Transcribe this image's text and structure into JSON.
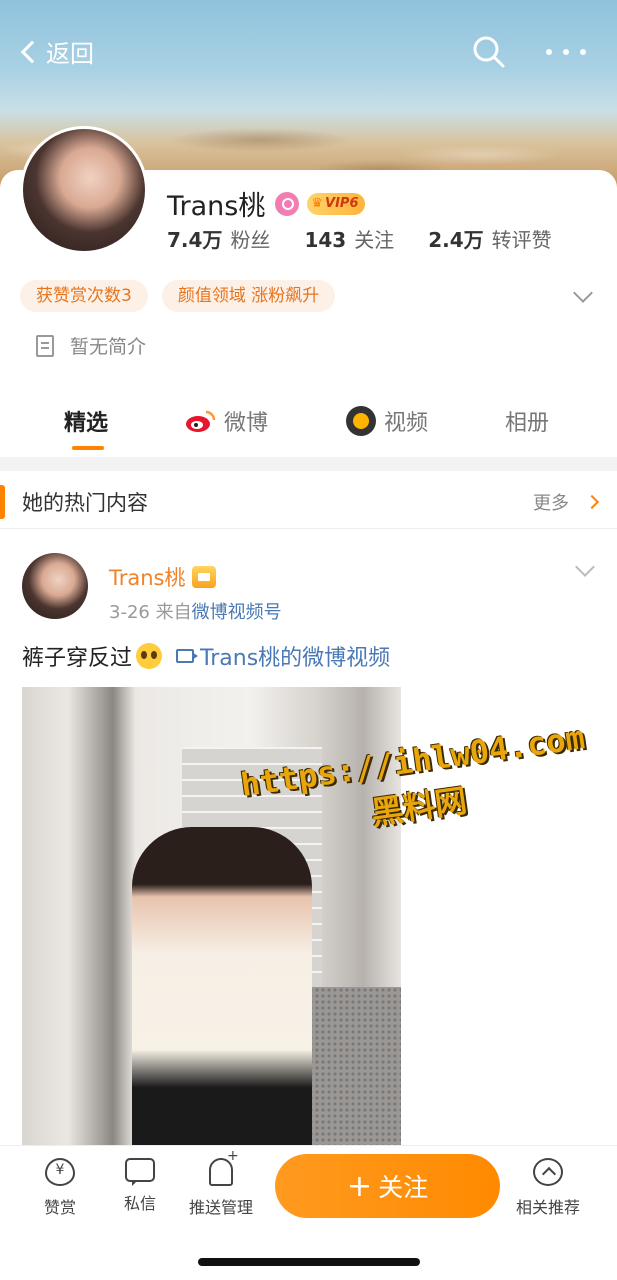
{
  "header": {
    "back_label": "返回"
  },
  "profile": {
    "name": "Trans桃",
    "vip_label": "VIP6",
    "stats": [
      {
        "value": "7.4万",
        "label": "粉丝"
      },
      {
        "value": "143",
        "label": "关注"
      },
      {
        "value": "2.4万",
        "label": "转评赞"
      }
    ],
    "tags": [
      "获赞赏次数3",
      "颜值领域 涨粉飙升"
    ],
    "bio": "暂无简介"
  },
  "tabs": [
    {
      "label": "精选",
      "active": true
    },
    {
      "label": "微博",
      "icon": "weibo-icon"
    },
    {
      "label": "视频",
      "icon": "video-icon"
    },
    {
      "label": "相册"
    }
  ],
  "hot": {
    "title": "她的热门内容",
    "more_label": "更多"
  },
  "post": {
    "author": "Trans桃",
    "date": "3-26",
    "from_prefix": "来自",
    "source": "微博视频号",
    "text": "裤子穿反过",
    "video_link": "Trans桃的微博视频"
  },
  "watermark": {
    "url": "https://ihlw04.com",
    "site": "黑料网"
  },
  "bottom_bar": {
    "reward_label": "赞赏",
    "message_label": "私信",
    "push_label": "推送管理",
    "follow_label": "关注",
    "follow_plus": "+",
    "recommend_label": "相关推荐"
  },
  "colors": {
    "accent": "#ff8200",
    "link": "#4a79b5",
    "tag_bg": "#fdf0e6",
    "tag_text": "#e6751f"
  }
}
